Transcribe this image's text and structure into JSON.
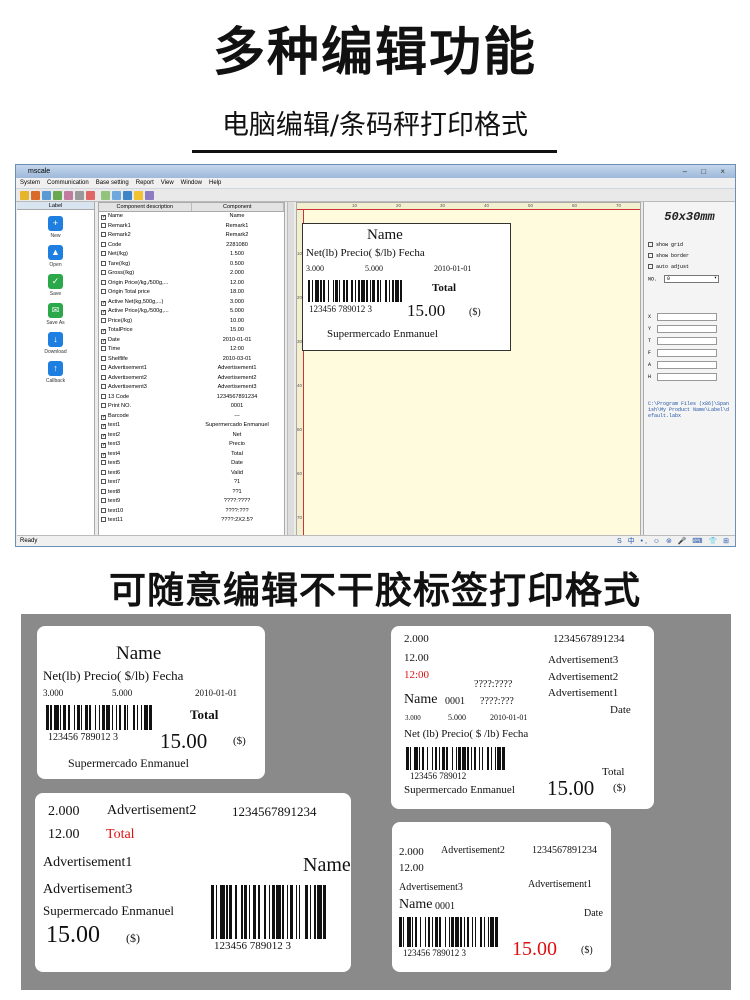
{
  "header": {
    "title": "多种编辑功能",
    "subtitle": "电脑编辑/条码秤打印格式"
  },
  "window": {
    "title": "mscale",
    "controls": "– □ ×",
    "menu": [
      "System",
      "Communication",
      "Base setting",
      "Report",
      "View",
      "Window",
      "Help"
    ],
    "sidebar": {
      "header": "Label",
      "buttons": [
        {
          "label": "New",
          "icon": "plus-icon",
          "color": "#1f7fe0"
        },
        {
          "label": "Open",
          "icon": "open-icon",
          "color": "#1f7fe0"
        },
        {
          "label": "Save",
          "icon": "check-icon",
          "color": "#2aa84a"
        },
        {
          "label": "Save As",
          "icon": "save-as-icon",
          "color": "#2aa84a"
        },
        {
          "label": "Download",
          "icon": "download-icon",
          "color": "#1f7fe0"
        },
        {
          "label": "Callback",
          "icon": "callback-icon",
          "color": "#1f7fe0"
        }
      ]
    },
    "components": {
      "headers": [
        "Component description",
        "Component"
      ],
      "rows": [
        {
          "checked": true,
          "desc": "Name",
          "value": "Name"
        },
        {
          "checked": false,
          "desc": "Remark1",
          "value": "Remark1"
        },
        {
          "checked": false,
          "desc": "Remark2",
          "value": "Remark2"
        },
        {
          "checked": false,
          "desc": "Code",
          "value": "2281080"
        },
        {
          "checked": false,
          "desc": "Net(/kg)",
          "value": "1.500"
        },
        {
          "checked": false,
          "desc": "Tare(/kg)",
          "value": "0.500"
        },
        {
          "checked": false,
          "desc": "Gross(/kg)",
          "value": "2.000"
        },
        {
          "checked": false,
          "desc": "Origin Price(/kg,/500g,...",
          "value": "12.00"
        },
        {
          "checked": false,
          "desc": "Origin Total price",
          "value": "18.00"
        },
        {
          "checked": true,
          "desc": "Active Net(kg,500g,...)",
          "value": "3.000"
        },
        {
          "checked": true,
          "desc": "Active Price(/kg,/500g,...",
          "value": "5.000"
        },
        {
          "checked": false,
          "desc": "Price(/kg)",
          "value": "10.00"
        },
        {
          "checked": true,
          "desc": "TotalPrice",
          "value": "15.00"
        },
        {
          "checked": true,
          "desc": "Date",
          "value": "2010-01-01"
        },
        {
          "checked": false,
          "desc": "Time",
          "value": "12:00"
        },
        {
          "checked": false,
          "desc": "Shelflife",
          "value": "2010-03-01"
        },
        {
          "checked": false,
          "desc": "Advertisement1",
          "value": "Advertisement1"
        },
        {
          "checked": false,
          "desc": "Advertisement2",
          "value": "Advertisement2"
        },
        {
          "checked": false,
          "desc": "Advertisement3",
          "value": "Advertisement3"
        },
        {
          "checked": false,
          "desc": "13 Code",
          "value": "1234567891234"
        },
        {
          "checked": false,
          "desc": "Print NO.",
          "value": "0001"
        },
        {
          "checked": true,
          "desc": "Barcode",
          "value": "---"
        },
        {
          "checked": true,
          "desc": "text1",
          "value": "Supermercado Enmanuel"
        },
        {
          "checked": true,
          "desc": "text2",
          "value": "Net"
        },
        {
          "checked": true,
          "desc": "text3",
          "value": "Precio"
        },
        {
          "checked": true,
          "desc": "text4",
          "value": "Total"
        },
        {
          "checked": false,
          "desc": "text5",
          "value": "Date"
        },
        {
          "checked": false,
          "desc": "text6",
          "value": "Valid"
        },
        {
          "checked": false,
          "desc": "text7",
          "value": "?1"
        },
        {
          "checked": false,
          "desc": "text8",
          "value": "??1"
        },
        {
          "checked": false,
          "desc": "text9",
          "value": "????:????"
        },
        {
          "checked": false,
          "desc": "text10",
          "value": "????:???"
        },
        {
          "checked": false,
          "desc": "text11",
          "value": "????:2X2.5?"
        }
      ]
    },
    "ruler_top": [
      "10",
      "20",
      "30",
      "40",
      "50",
      "60",
      "70"
    ],
    "ruler_left": [
      "10",
      "20",
      "30",
      "40",
      "50",
      "60",
      "70"
    ],
    "canvas_label": {
      "name": "Name",
      "header_line": "Net(lb) Precio( $/lb) Fecha",
      "net": "3.000",
      "price": "5.000",
      "date": "2010-01-01",
      "total_label": "Total",
      "barcode_digits": "123456 789012 3",
      "total": "15.00",
      "currency": "($)",
      "store": "Supermercado Enmanuel"
    },
    "panel": {
      "size_label": "50x30mm",
      "options": [
        "show grid",
        "show border",
        "auto adjust"
      ],
      "no_label": "NO.",
      "no_value": "0",
      "fields": [
        "X",
        "Y",
        "T",
        "F",
        "A",
        "H"
      ],
      "path": "C:\\Program Files (x86)\\Spanish\\My Product Name\\Label\\default.labx"
    },
    "status": "Ready",
    "tray": "S 中 •, ☺ ⊚ 🎤 ⌨ 👕 ⊞"
  },
  "section2_title": "可随意编辑不干胶标签打印格式",
  "cards": {
    "a": {
      "name": "Name",
      "header_line": "Net(lb) Precio( $/lb) Fecha",
      "net": "3.000",
      "price": "5.000",
      "date": "2010-01-01",
      "total_label": "Total",
      "digits": "123456 789012 3",
      "total": "15.00",
      "currency": "($)",
      "store": "Supermercado Enmanuel"
    },
    "b": {
      "gross": "2.000",
      "code13": "1234567891234",
      "price": "12.00",
      "adv3": "Advertisement3",
      "time": "12:00",
      "adv2": "Advertisement2",
      "t9": "????:????",
      "adv1": "Advertisement1",
      "name": "Name",
      "no": "0001",
      "t10": "????:???",
      "date_label": "Date",
      "net": "3.000",
      "aprice": "5.000",
      "date": "2010-01-01",
      "header_line": "Net (lb) Precio( $ /lb) Fecha",
      "digits": "123456 789012",
      "total_label": "Total",
      "store": "Supermercado Enmanuel",
      "total": "15.00",
      "currency": "($)"
    },
    "c": {
      "gross": "2.000",
      "adv2": "Advertisement2",
      "code13": "1234567891234",
      "price": "12.00",
      "total_label": "Total",
      "adv1": "Advertisement1",
      "name": "Name",
      "adv3": "Advertisement3",
      "store": "Supermercado Enmanuel",
      "total": "15.00",
      "currency": "($)",
      "digits": "123456 789012 3"
    },
    "d": {
      "gross": "2.000",
      "adv2": "Advertisement2",
      "code13": "1234567891234",
      "price": "12.00",
      "adv3": "Advertisement3",
      "adv1": "Advertisement1",
      "name": "Name",
      "no": "0001",
      "date_label": "Date",
      "digits": "123456 789012 3",
      "total": "15.00",
      "currency": "($)"
    }
  }
}
